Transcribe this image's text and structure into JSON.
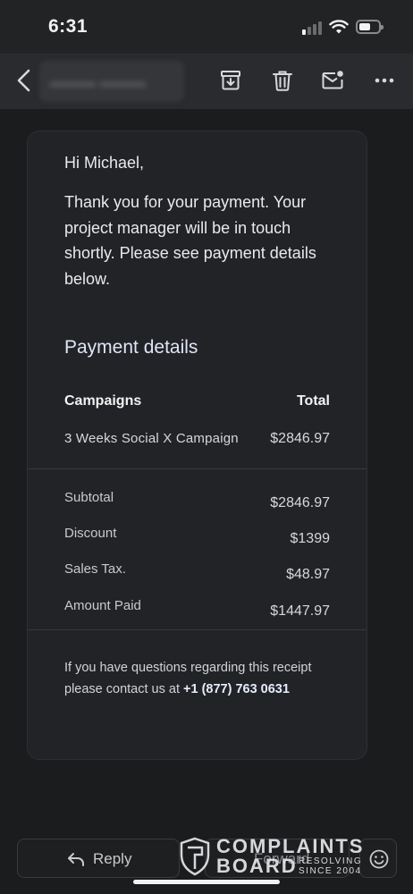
{
  "status_bar": {
    "time": "6:31",
    "signal_icon": "cellular-signal-icon",
    "wifi_icon": "wifi-icon",
    "battery_icon": "battery-icon"
  },
  "toolbar": {
    "back_icon": "chevron-left-icon",
    "archive_icon": "archive-icon",
    "trash_icon": "trash-icon",
    "mark_unread_icon": "mail-unread-icon",
    "more_icon": "more-horizontal-icon"
  },
  "email": {
    "greeting": "Hi Michael,",
    "body": "Thank you for your payment. Your project manager will be in touch shortly. Please see payment details below.",
    "section_title": "Payment details",
    "table": {
      "header_left": "Campaigns",
      "header_right": "Total",
      "items": [
        {
          "name": "3 Weeks Social X Campaign",
          "price": "$2846.97"
        }
      ]
    },
    "summary": [
      {
        "label": "Subtotal",
        "value": "$2846.97"
      },
      {
        "label": "Discount",
        "value": "$1399"
      },
      {
        "label": "Sales Tax.",
        "value": "$48.97"
      },
      {
        "label": "Amount Paid",
        "value": "$1447.97"
      }
    ],
    "footer_text": "If you have questions regarding this receipt please contact us at",
    "footer_phone": "+1 (877) 763 0631"
  },
  "actions": {
    "reply_label": "Reply",
    "reply_icon": "reply-arrow-icon",
    "forward_label": "Forward",
    "emoji_icon": "emoji-smile-icon"
  },
  "watermark": {
    "line1": "COMPLAINTS",
    "line2": "BOARD",
    "tag1": "RESOLVING",
    "tag2": "SINCE 2004"
  },
  "colors": {
    "background": "#1b1c1e",
    "card": "#222326",
    "accent_title": "#dfe5f7",
    "text": "#e9eaec"
  }
}
